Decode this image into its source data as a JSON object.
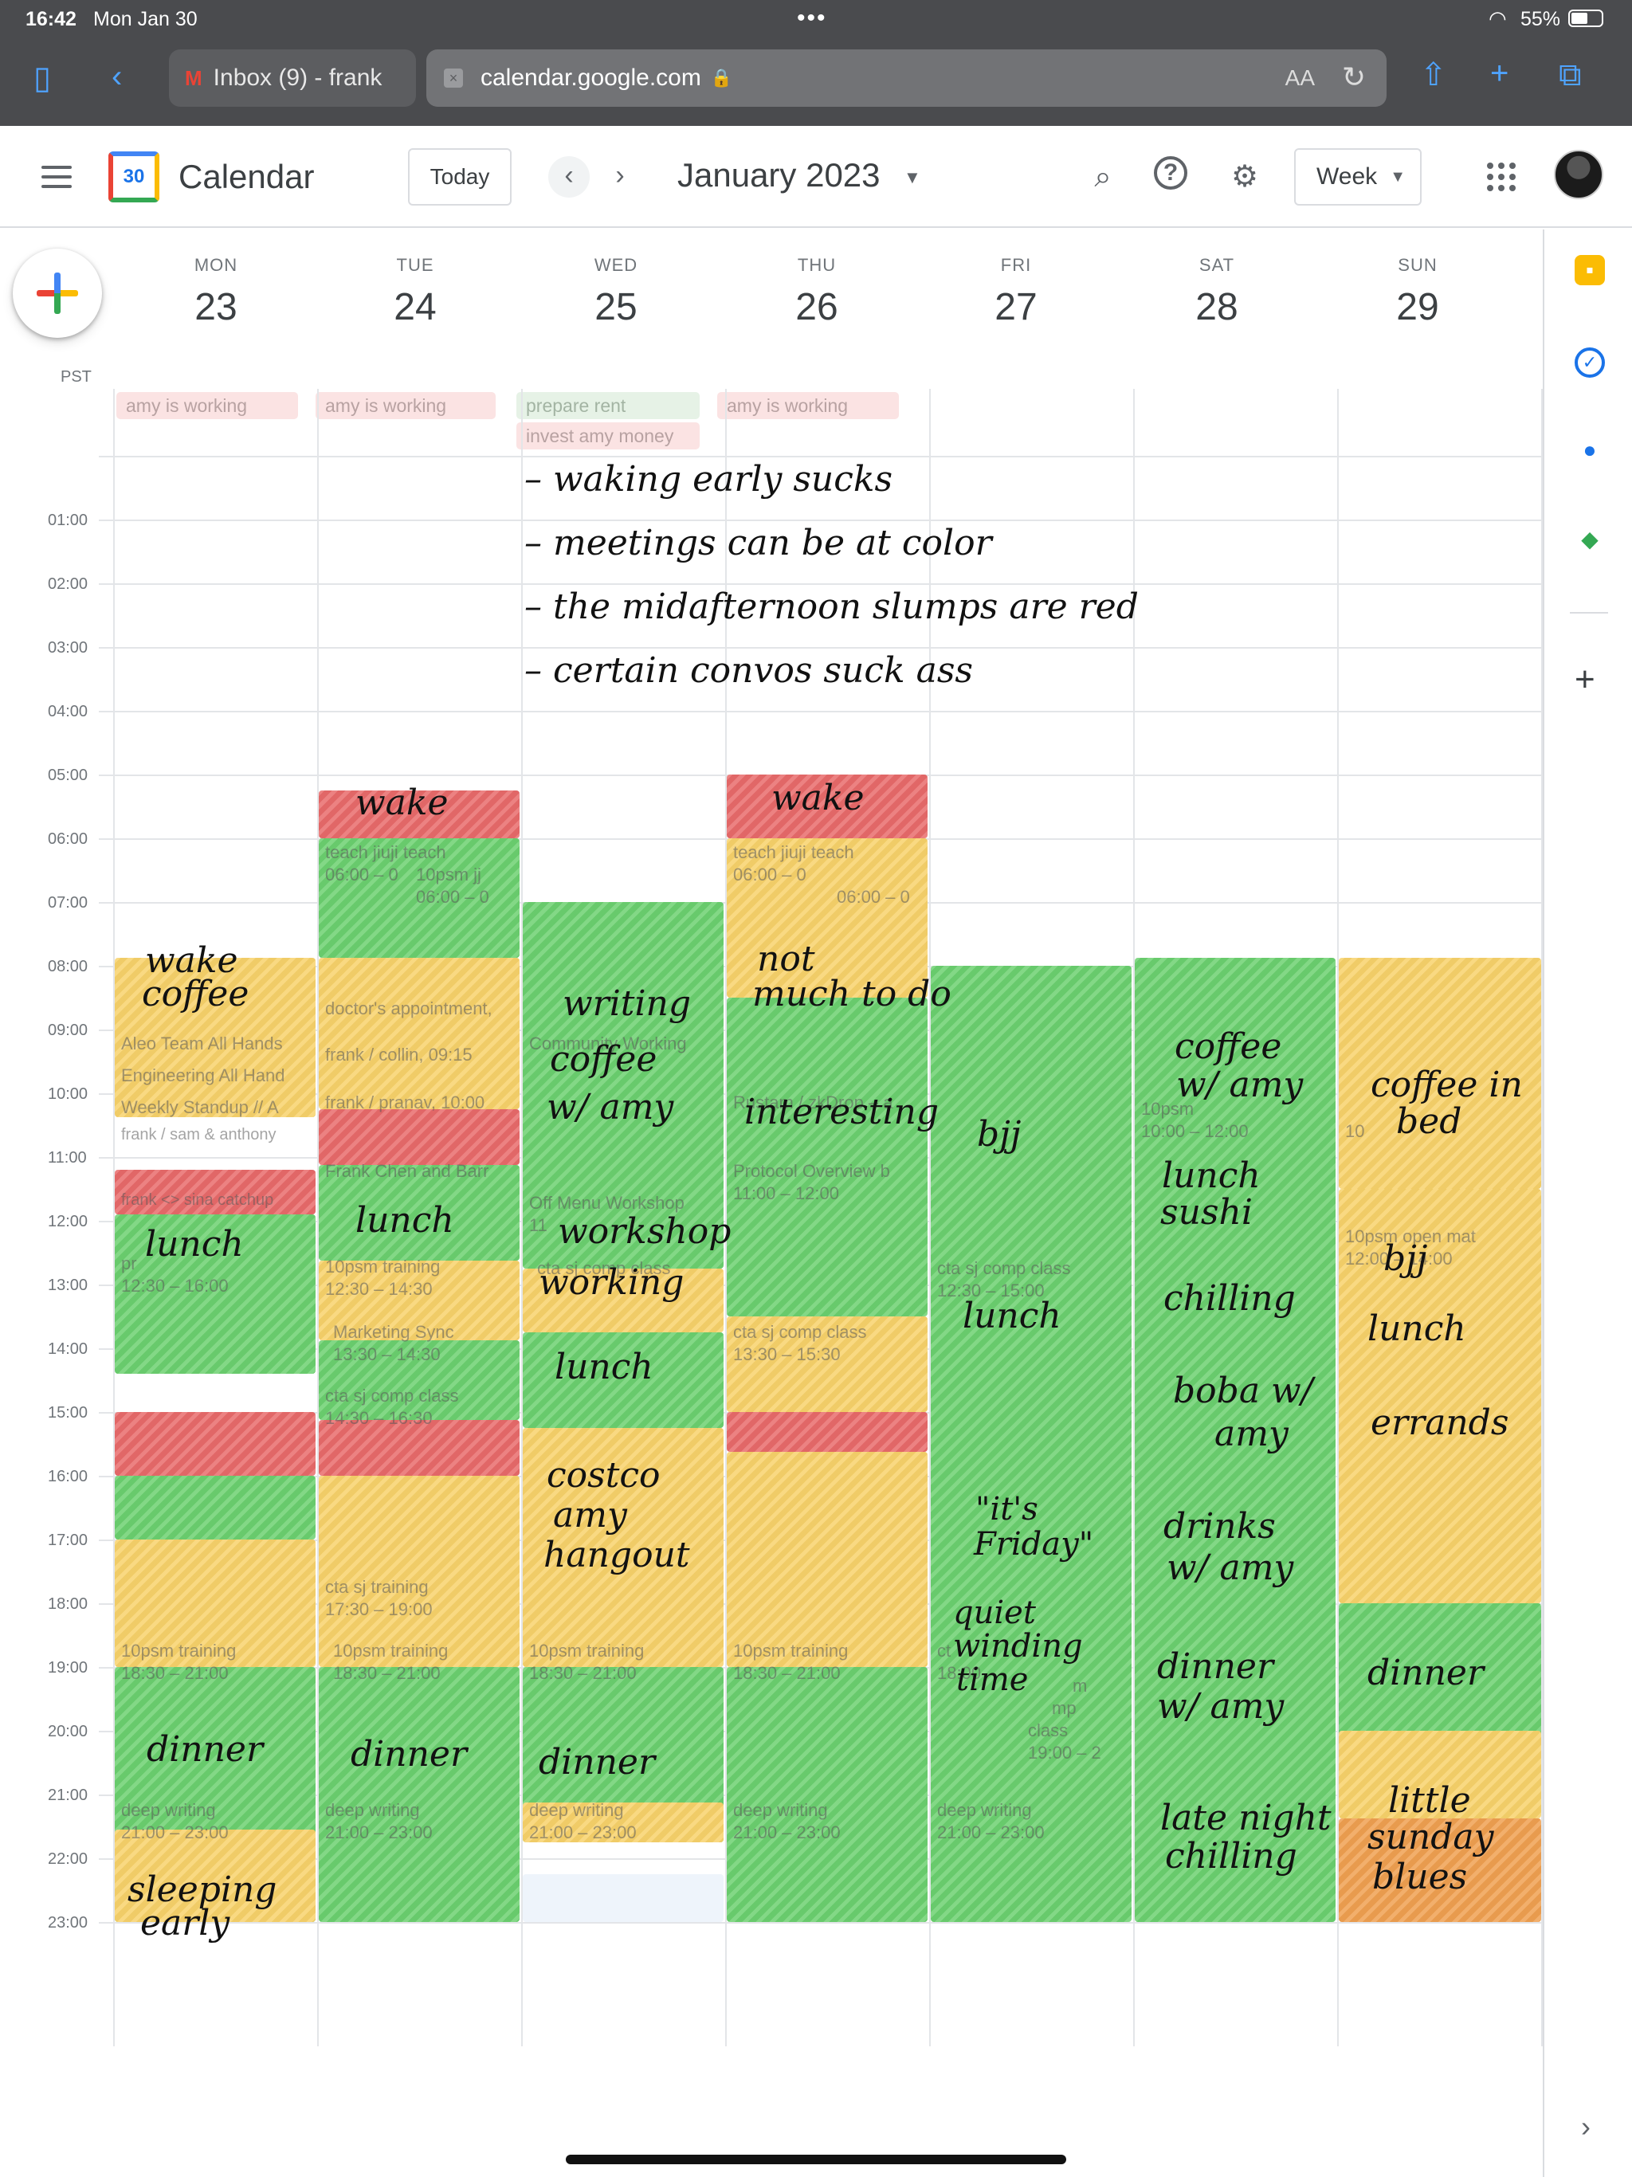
{
  "status_bar": {
    "time": "16:42",
    "date": "Mon Jan 30",
    "battery": "55%"
  },
  "browser": {
    "tab_title": "Inbox (9) - frank",
    "url": "calendar.google.com",
    "reader_label": "AA"
  },
  "header": {
    "app_title": "Calendar",
    "logo_day": "30",
    "today_label": "Today",
    "month_label": "January 2023",
    "view_label": "Week"
  },
  "timezone": "PST",
  "days": [
    {
      "dow": "MON",
      "num": "23"
    },
    {
      "dow": "TUE",
      "num": "24"
    },
    {
      "dow": "WED",
      "num": "25"
    },
    {
      "dow": "THU",
      "num": "26"
    },
    {
      "dow": "FRI",
      "num": "27"
    },
    {
      "dow": "SAT",
      "num": "28"
    },
    {
      "dow": "SUN",
      "num": "29"
    }
  ],
  "all_day": [
    {
      "text": "amy is working",
      "color": "red"
    },
    {
      "text": "amy is working",
      "color": "red"
    },
    {
      "text": "prepare rent",
      "color": "green"
    },
    {
      "text": "invest amy money",
      "color": "red"
    },
    {
      "text": "amy is working",
      "color": "red"
    }
  ],
  "hours": [
    "01:00",
    "02:00",
    "03:00",
    "04:00",
    "05:00",
    "06:00",
    "07:00",
    "08:00",
    "09:00",
    "10:00",
    "11:00",
    "12:00",
    "13:00",
    "14:00",
    "15:00",
    "16:00",
    "17:00",
    "18:00",
    "19:00",
    "20:00",
    "21:00",
    "22:00",
    "23:00"
  ],
  "notes": [
    "– waking early sucks",
    "– meetings can be at color",
    "– the midafternoon slumps are red",
    "– certain convos suck ass"
  ],
  "events": {
    "mon": [
      "Aleo Team All Hands",
      "Engineering All Hand",
      "Weekly Standup // A",
      "frank / sam & anthony",
      "frank <> sina catchup",
      "pr",
      "12:30 – 16:00",
      "10psm training",
      "18:30 – 21:00",
      "deep writing",
      "21:00 – 23:00"
    ],
    "tue": [
      "teach jiuji teach",
      "06:00 – 0",
      "10psm jj",
      "06:00 – 0",
      "doctor's appointment,",
      "frank / collin, 09:15",
      "frank / pranav, 10:00",
      "Frank Chen and Barr",
      "10psm training",
      "12:30 – 14:30",
      "Marketing Sync",
      "13:30 – 14:30",
      "cta sj comp class",
      "14:30 – 16:30",
      "cta sj training",
      "17:30 – 19:00",
      "10psm training",
      "18:30 – 21:00",
      "deep writing",
      "21:00 – 23:00"
    ],
    "wed": [
      "Community Working",
      "Off Menu Workshop",
      "11",
      "cta sj comp class",
      "10psm training",
      "18:30 – 21:00",
      "deep writing",
      "21:00 – 23:00"
    ],
    "thu": [
      "teach jiuji teach",
      "06:00 – 0",
      "06:00 – 0",
      "Rustam / zkDrop – a",
      "Protocol Overview b",
      "11:00 – 12:00",
      "cta sj comp class",
      "13:30 – 15:30",
      "10psm training",
      "18:30 – 21:00",
      "deep writing",
      "21:00 – 23:00"
    ],
    "fri": [
      "cta sj comp class",
      "12:30 – 15:00",
      "ct",
      "18:00",
      "m",
      "mp",
      "class",
      "19:00 – 2",
      "deep writing",
      "21:00 – 23:00"
    ],
    "sat": [
      "10psm",
      "10:00 – 12:00"
    ],
    "sun": [
      "10",
      "10psm open mat",
      "12:00 – 14:00"
    ]
  },
  "handwriting": {
    "mon": [
      "wake",
      "coffee",
      "lunch",
      "dinner",
      "sleeping",
      "early"
    ],
    "tue": [
      "wake",
      "lunch",
      "dinner"
    ],
    "wed": [
      "writing",
      "coffee",
      "w/ amy",
      "workshop",
      "working",
      "lunch",
      "costco",
      "amy",
      "hangout",
      "dinner"
    ],
    "thu": [
      "wake",
      "not",
      "much to do",
      "interesting"
    ],
    "fri": [
      "bjj",
      "lunch",
      "\"it's",
      "Friday\"",
      "quiet",
      "winding",
      "time"
    ],
    "sat": [
      "coffee",
      "w/ amy",
      "lunch",
      "sushi",
      "chilling",
      "boba w/",
      "amy",
      "drinks",
      "w/ amy",
      "dinner",
      "w/ amy",
      "late night",
      "chilling"
    ],
    "sun": [
      "coffee in",
      "bed",
      "bjj",
      "lunch",
      "errands",
      "dinner",
      "little",
      "sunday",
      "blues"
    ]
  },
  "colors": {
    "yellow": "#f8d26a",
    "green": "#6bd06f",
    "red": "#e86a6a",
    "orange": "#f0a050",
    "accent": "#1a73e8"
  }
}
